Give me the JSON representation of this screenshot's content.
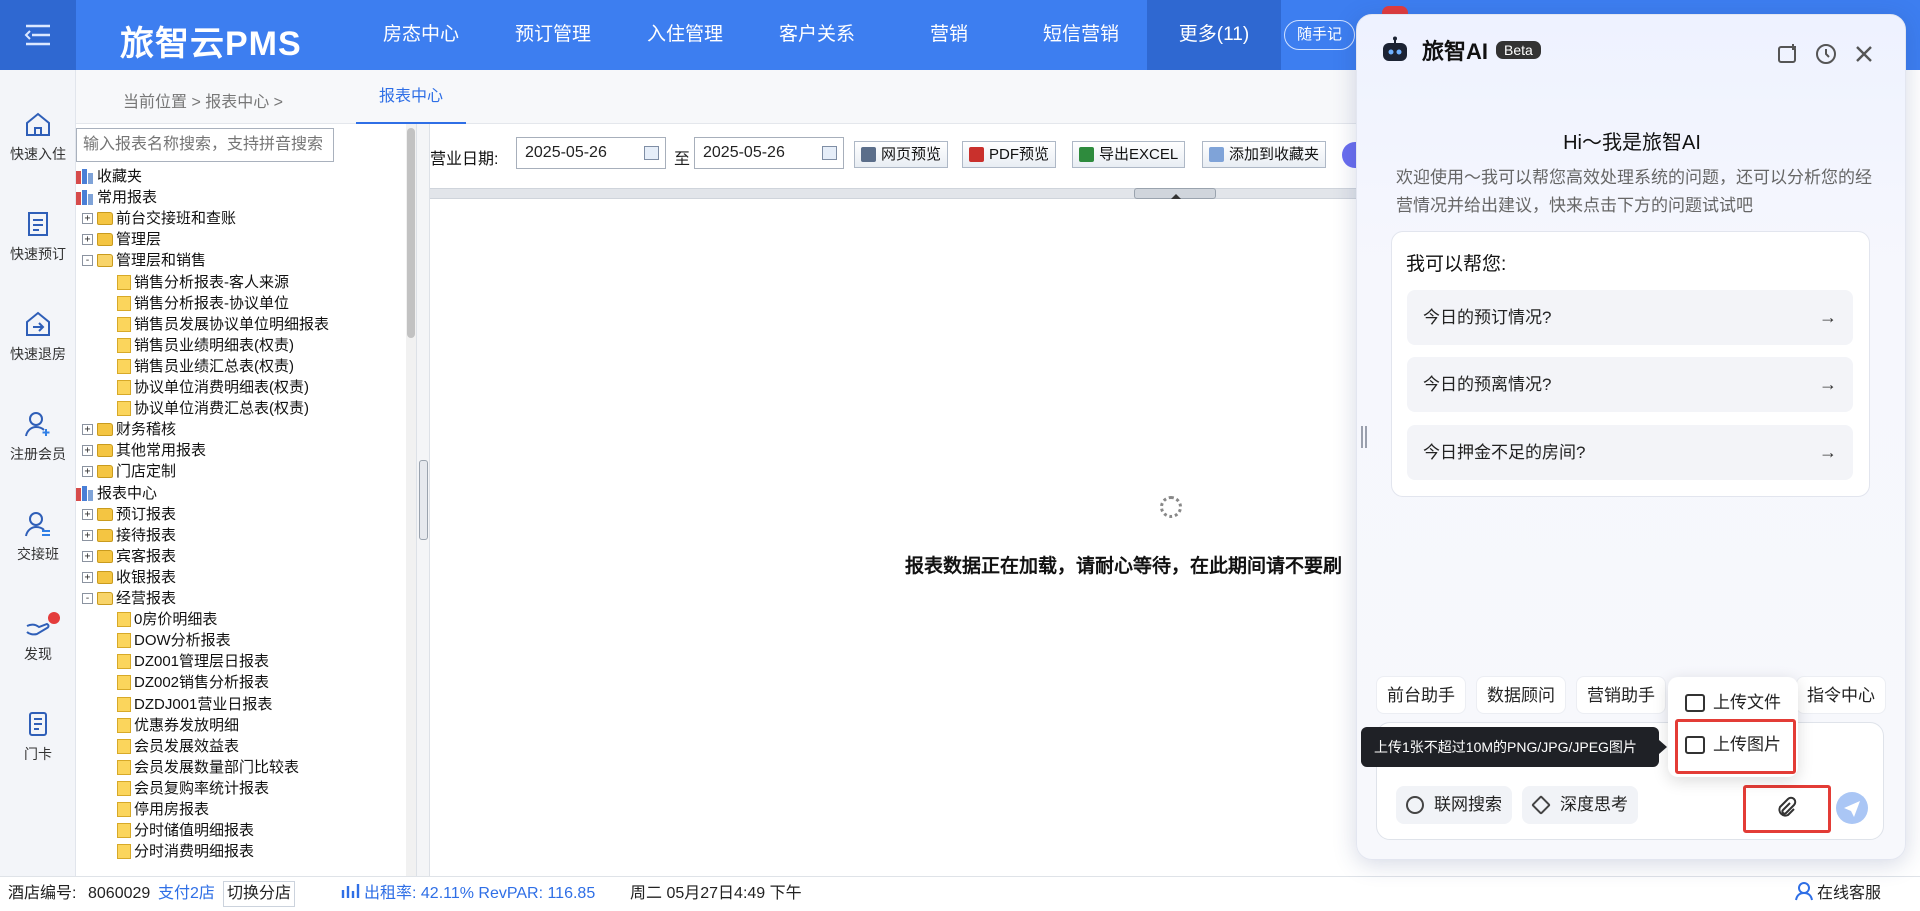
{
  "app": {
    "brand": "旅智云PMS"
  },
  "nav": {
    "items": [
      "房态中心",
      "预订管理",
      "入住管理",
      "客户关系",
      "营销",
      "短信营销"
    ],
    "more": "更多(11)",
    "memo": "随手记"
  },
  "sidebar": {
    "items": [
      {
        "label": "快速入住",
        "icon": "home-icon"
      },
      {
        "label": "快速预订",
        "icon": "booking-icon"
      },
      {
        "label": "快速退房",
        "icon": "checkout-icon"
      },
      {
        "label": "注册会员",
        "icon": "add-user-icon"
      },
      {
        "label": "交接班",
        "icon": "shift-change-icon"
      },
      {
        "label": "发现",
        "icon": "discover-icon"
      },
      {
        "label": "门卡",
        "icon": "door-card-icon"
      }
    ]
  },
  "breadcrumb": {
    "text": "当前位置 >  报表中心  >",
    "tab": "报表中心"
  },
  "tree": {
    "search_placeholder": "输入报表名称搜索，支持拼音搜索",
    "rows": [
      {
        "label": "收藏夹",
        "type": "books",
        "indent": 0,
        "exp": ""
      },
      {
        "label": "常用报表",
        "type": "books",
        "indent": 0,
        "exp": ""
      },
      {
        "label": "前台交接班和查账",
        "type": "folder",
        "indent": 1,
        "exp": "+"
      },
      {
        "label": "管理层",
        "type": "folder",
        "indent": 1,
        "exp": "+"
      },
      {
        "label": "管理层和销售",
        "type": "folder-open",
        "indent": 1,
        "exp": "-"
      },
      {
        "label": "销售分析报表-客人来源",
        "type": "doc",
        "indent": 2,
        "exp": ""
      },
      {
        "label": "销售分析报表-协议单位",
        "type": "doc",
        "indent": 2,
        "exp": ""
      },
      {
        "label": "销售员发展协议单位明细报表",
        "type": "doc",
        "indent": 2,
        "exp": ""
      },
      {
        "label": "销售员业绩明细表(权责)",
        "type": "doc",
        "indent": 2,
        "exp": ""
      },
      {
        "label": "销售员业绩汇总表(权责)",
        "type": "doc",
        "indent": 2,
        "exp": ""
      },
      {
        "label": "协议单位消费明细表(权责)",
        "type": "doc",
        "indent": 2,
        "exp": ""
      },
      {
        "label": "协议单位消费汇总表(权责)",
        "type": "doc",
        "indent": 2,
        "exp": ""
      },
      {
        "label": "财务稽核",
        "type": "folder",
        "indent": 1,
        "exp": "+"
      },
      {
        "label": "其他常用报表",
        "type": "folder",
        "indent": 1,
        "exp": "+"
      },
      {
        "label": "门店定制",
        "type": "folder",
        "indent": 1,
        "exp": "+"
      },
      {
        "label": "报表中心",
        "type": "books",
        "indent": 0,
        "exp": ""
      },
      {
        "label": "预订报表",
        "type": "folder",
        "indent": 1,
        "exp": "+"
      },
      {
        "label": "接待报表",
        "type": "folder",
        "indent": 1,
        "exp": "+"
      },
      {
        "label": "宾客报表",
        "type": "folder",
        "indent": 1,
        "exp": "+"
      },
      {
        "label": "收银报表",
        "type": "folder",
        "indent": 1,
        "exp": "+"
      },
      {
        "label": "经营报表",
        "type": "folder-open",
        "indent": 1,
        "exp": "-"
      },
      {
        "label": "0房价明细表",
        "type": "doc",
        "indent": 2,
        "exp": ""
      },
      {
        "label": "DOW分析报表",
        "type": "doc",
        "indent": 2,
        "exp": ""
      },
      {
        "label": "DZ001管理层日报表",
        "type": "doc",
        "indent": 2,
        "exp": ""
      },
      {
        "label": "DZ002销售分析报表",
        "type": "doc",
        "indent": 2,
        "exp": ""
      },
      {
        "label": "DZDJ001营业日报表",
        "type": "doc",
        "indent": 2,
        "exp": ""
      },
      {
        "label": "优惠券发放明细",
        "type": "doc",
        "indent": 2,
        "exp": ""
      },
      {
        "label": "会员发展效益表",
        "type": "doc",
        "indent": 2,
        "exp": ""
      },
      {
        "label": "会员发展数量部门比较表",
        "type": "doc",
        "indent": 2,
        "exp": ""
      },
      {
        "label": "会员复购率统计报表",
        "type": "doc",
        "indent": 2,
        "exp": ""
      },
      {
        "label": "停用房报表",
        "type": "doc",
        "indent": 2,
        "exp": ""
      },
      {
        "label": "分时储值明细报表",
        "type": "doc",
        "indent": 2,
        "exp": ""
      },
      {
        "label": "分时消费明细报表",
        "type": "doc",
        "indent": 2,
        "exp": ""
      }
    ]
  },
  "toolbar": {
    "date_label": "营业日期:",
    "date_from": "2025-05-26",
    "to_label": "至",
    "date_to": "2025-05-26",
    "buttons": [
      "网页预览",
      "PDF预览",
      "导出EXCEL",
      "添加到收藏夹"
    ]
  },
  "report": {
    "loading_text": "报表数据正在加载，请耐心等待，在此期间请不要刷"
  },
  "status": {
    "hotel_label": "酒店编号:",
    "hotel_id": "8060029",
    "pay_link": "支付2店",
    "switch_store": "切换分店",
    "occupancy": "出租率: 42.11% RevPAR: 116.85",
    "datetime": "周二 05月27日4:49 下午",
    "service": "在线客服"
  },
  "ai": {
    "title": "旅智AI",
    "beta": "Beta",
    "greeting": "Hi～我是旅智AI",
    "description": "欢迎使用～我可以帮您高效处理系统的问题，还可以分析您的经营情况并给出建议，快来点击下方的问题试试吧",
    "help_title": "我可以帮您:",
    "questions": [
      "今日的预订情况?",
      "今日的预离情况?",
      "今日押金不足的房间?"
    ],
    "arrow": "→",
    "chips": [
      "前台助手",
      "数据顾问",
      "营销助手",
      "指令中心"
    ],
    "upload_file": "上传文件",
    "upload_image": "上传图片",
    "tooltip": "上传1张不超过10M的PNG/JPG/JPEG图片",
    "web_search": "联网搜索",
    "deep_think": "深度思考"
  },
  "colors": {
    "primary": "#3d7ef0",
    "accent_red": "#e33c36",
    "link": "#2f6fe6"
  }
}
